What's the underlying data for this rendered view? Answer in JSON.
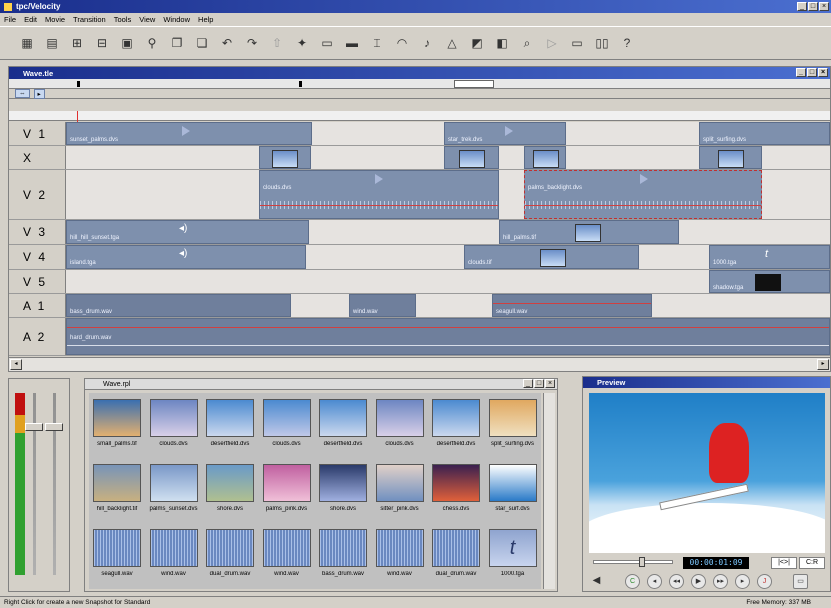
{
  "app": {
    "title": "tpc/Velocity"
  },
  "menu": [
    "File",
    "Edit",
    "Movie",
    "Transition",
    "Tools",
    "View",
    "Window",
    "Help"
  ],
  "timeline": {
    "title": "Wave.tle",
    "tracks": [
      {
        "id": "v1",
        "name": "V 1",
        "clips": [
          "sunset_palms.dvs",
          "star_trek.dvs",
          "split_surfing.dvs"
        ]
      },
      {
        "id": "x",
        "name": "X",
        "clips": []
      },
      {
        "id": "v2",
        "name": "V 2",
        "clips": [
          "clouds.dvs",
          "palms_backlight.dvs"
        ]
      },
      {
        "id": "v3",
        "name": "V 3",
        "clips": [
          "hill_hill_sunset.tga",
          "hill_palms.tif"
        ]
      },
      {
        "id": "v4",
        "name": "V 4",
        "clips": [
          "island.tga",
          "clouds.tif",
          "1000.tga"
        ]
      },
      {
        "id": "v5",
        "name": "V 5",
        "clips": [
          "shadow.tga"
        ]
      },
      {
        "id": "a1",
        "name": "A 1",
        "clips": [
          "bass_drum.wav",
          "wind.wav",
          "seagull.wav"
        ]
      },
      {
        "id": "a2",
        "name": "A 2",
        "clips": [
          "hard_drum.wav"
        ]
      }
    ]
  },
  "bin": {
    "title": "Wave.rpl",
    "items": [
      {
        "label": "small_palms.tif"
      },
      {
        "label": "clouds.dvs"
      },
      {
        "label": "desertfield.dvs"
      },
      {
        "label": "clouds.dvs"
      },
      {
        "label": "desertfield.dvs"
      },
      {
        "label": "clouds.dvs"
      },
      {
        "label": "desertfield.dvs"
      },
      {
        "label": "split_surfing.dvs"
      },
      {
        "label": "hill_backlight.tif"
      },
      {
        "label": "palms_sunset.dvs"
      },
      {
        "label": "shore.dvs"
      },
      {
        "label": "palms_pink.dvs"
      },
      {
        "label": "shore.dvs"
      },
      {
        "label": "sitter_pink.dvs"
      },
      {
        "label": "chess.dvs"
      },
      {
        "label": "star_surf.dvs"
      },
      {
        "label": "seagull.wav"
      },
      {
        "label": "wind.wav"
      },
      {
        "label": "dual_drum.wav"
      },
      {
        "label": "wind.wav"
      },
      {
        "label": "bass_drum.wav"
      },
      {
        "label": "wind.wav"
      },
      {
        "label": "dual_drum.wav"
      },
      {
        "label": "1000.tga"
      }
    ]
  },
  "preview": {
    "title": "Preview",
    "timecode": "00:00:01:09",
    "nav_left": "|<>|",
    "nav_right": "C:R"
  },
  "status": {
    "left": "Right Click for create a new Snapshot for Standard",
    "right": "Free Memory: 337 MB"
  }
}
